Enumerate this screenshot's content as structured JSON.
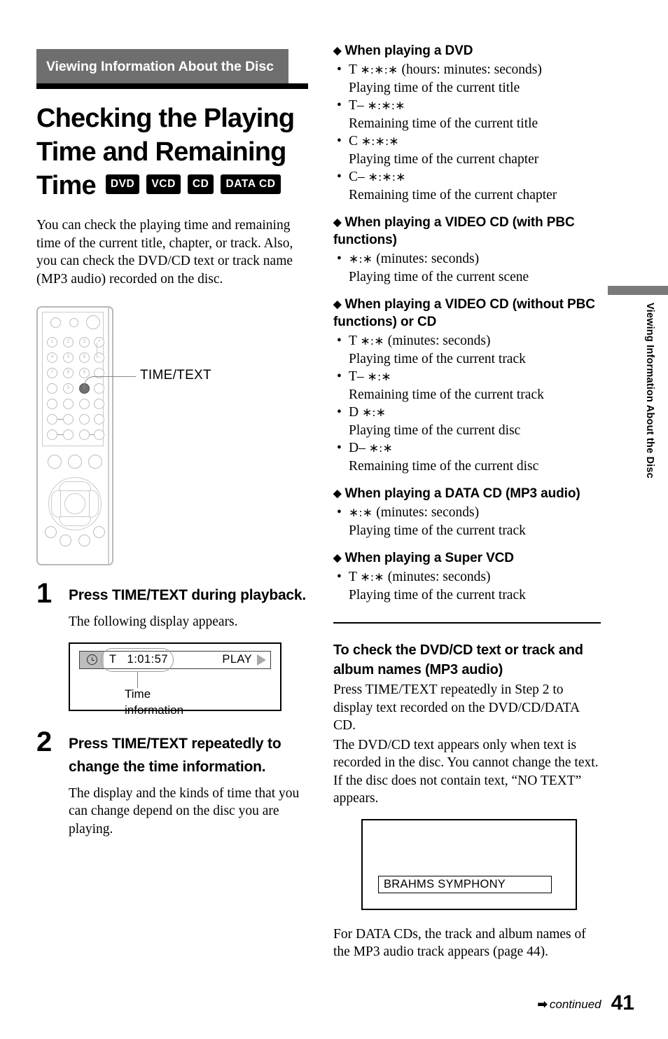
{
  "section_header": {
    "title": "Viewing Information About the Disc"
  },
  "main_title": {
    "line1": "Checking the Playing",
    "line2": "Time and Remaining",
    "line3": "Time",
    "badges": [
      "DVD",
      "VCD",
      "CD",
      "DATA CD"
    ]
  },
  "intro": "You can check the playing time and remaining time of the current title, chapter, or track. Also, you can check the DVD/CD text or track name (MP3 audio) recorded on the disc.",
  "remote": {
    "callout_label": "TIME/TEXT",
    "keys": [
      "1",
      "2",
      "3",
      "4",
      "5",
      "6",
      "7",
      "8",
      "9",
      "0"
    ],
    "volume_plus": "+",
    "volume_minus": "–"
  },
  "steps": [
    {
      "number": "1",
      "heading": "Press TIME/TEXT during playback.",
      "body": "The following display appears."
    },
    {
      "number": "2",
      "heading": "Press TIME/TEXT repeatedly to change the time information.",
      "body": "The display and the kinds of time that you can change depend on the disc you are playing."
    }
  ],
  "osd": {
    "time_value": "T   1:01:57",
    "play_label": "PLAY",
    "caption_line1": "Time",
    "caption_line2": "information"
  },
  "disc_sections": [
    {
      "heading": "When playing a DVD",
      "items": [
        {
          "code": "T",
          "time": "∗:∗:∗",
          "unit": "(hours: minutes: seconds)",
          "desc": "Playing time of the current title"
        },
        {
          "code": "T–",
          "time": "∗:∗:∗",
          "unit": "",
          "desc": "Remaining time of the current title"
        },
        {
          "code": "C",
          "time": "∗:∗:∗",
          "unit": "",
          "desc": "Playing time of the current chapter"
        },
        {
          "code": "C–",
          "time": "∗:∗:∗",
          "unit": "",
          "desc": "Remaining time of the current chapter"
        }
      ]
    },
    {
      "heading": "When playing a VIDEO CD (with PBC functions)",
      "items": [
        {
          "code": "",
          "time": "∗:∗",
          "unit": "(minutes: seconds)",
          "desc": "Playing time of the current scene"
        }
      ]
    },
    {
      "heading": "When playing a VIDEO CD (without PBC functions) or CD",
      "items": [
        {
          "code": "T",
          "time": "∗:∗",
          "unit": "(minutes: seconds)",
          "desc": "Playing time of the current track"
        },
        {
          "code": "T–",
          "time": "∗:∗",
          "unit": "",
          "desc": "Remaining time of the current track"
        },
        {
          "code": "D",
          "time": "∗:∗",
          "unit": "",
          "desc": "Playing time of the current disc"
        },
        {
          "code": "D–",
          "time": "∗:∗",
          "unit": "",
          "desc": "Remaining time of the current disc"
        }
      ]
    },
    {
      "heading": "When playing a DATA CD (MP3 audio)",
      "items": [
        {
          "code": "",
          "time": "∗:∗",
          "unit": "(minutes: seconds)",
          "desc": "Playing time of the current track"
        }
      ]
    },
    {
      "heading": "When playing a Super VCD",
      "items": [
        {
          "code": "T",
          "time": "∗:∗",
          "unit": "(minutes: seconds)",
          "desc": "Playing time of the current track"
        }
      ]
    }
  ],
  "text_check": {
    "heading": "To check the DVD/CD text or track and album names (MP3 audio)",
    "para1": "Press TIME/TEXT repeatedly in Step 2 to display text recorded on the DVD/CD/DATA CD.",
    "para2": "The DVD/CD text appears only when text is recorded in the disc. You cannot change the text. If the disc does not contain text, “NO TEXT” appears.",
    "display_value": "BRAHMS  SYMPHONY",
    "para3": "For DATA CDs, the track and album names of the MP3 audio track appears (page 44)."
  },
  "side_tab": {
    "label": "Viewing Information About the Disc"
  },
  "footer": {
    "arrow": "➡",
    "continued": "continued",
    "page_number": "41"
  }
}
